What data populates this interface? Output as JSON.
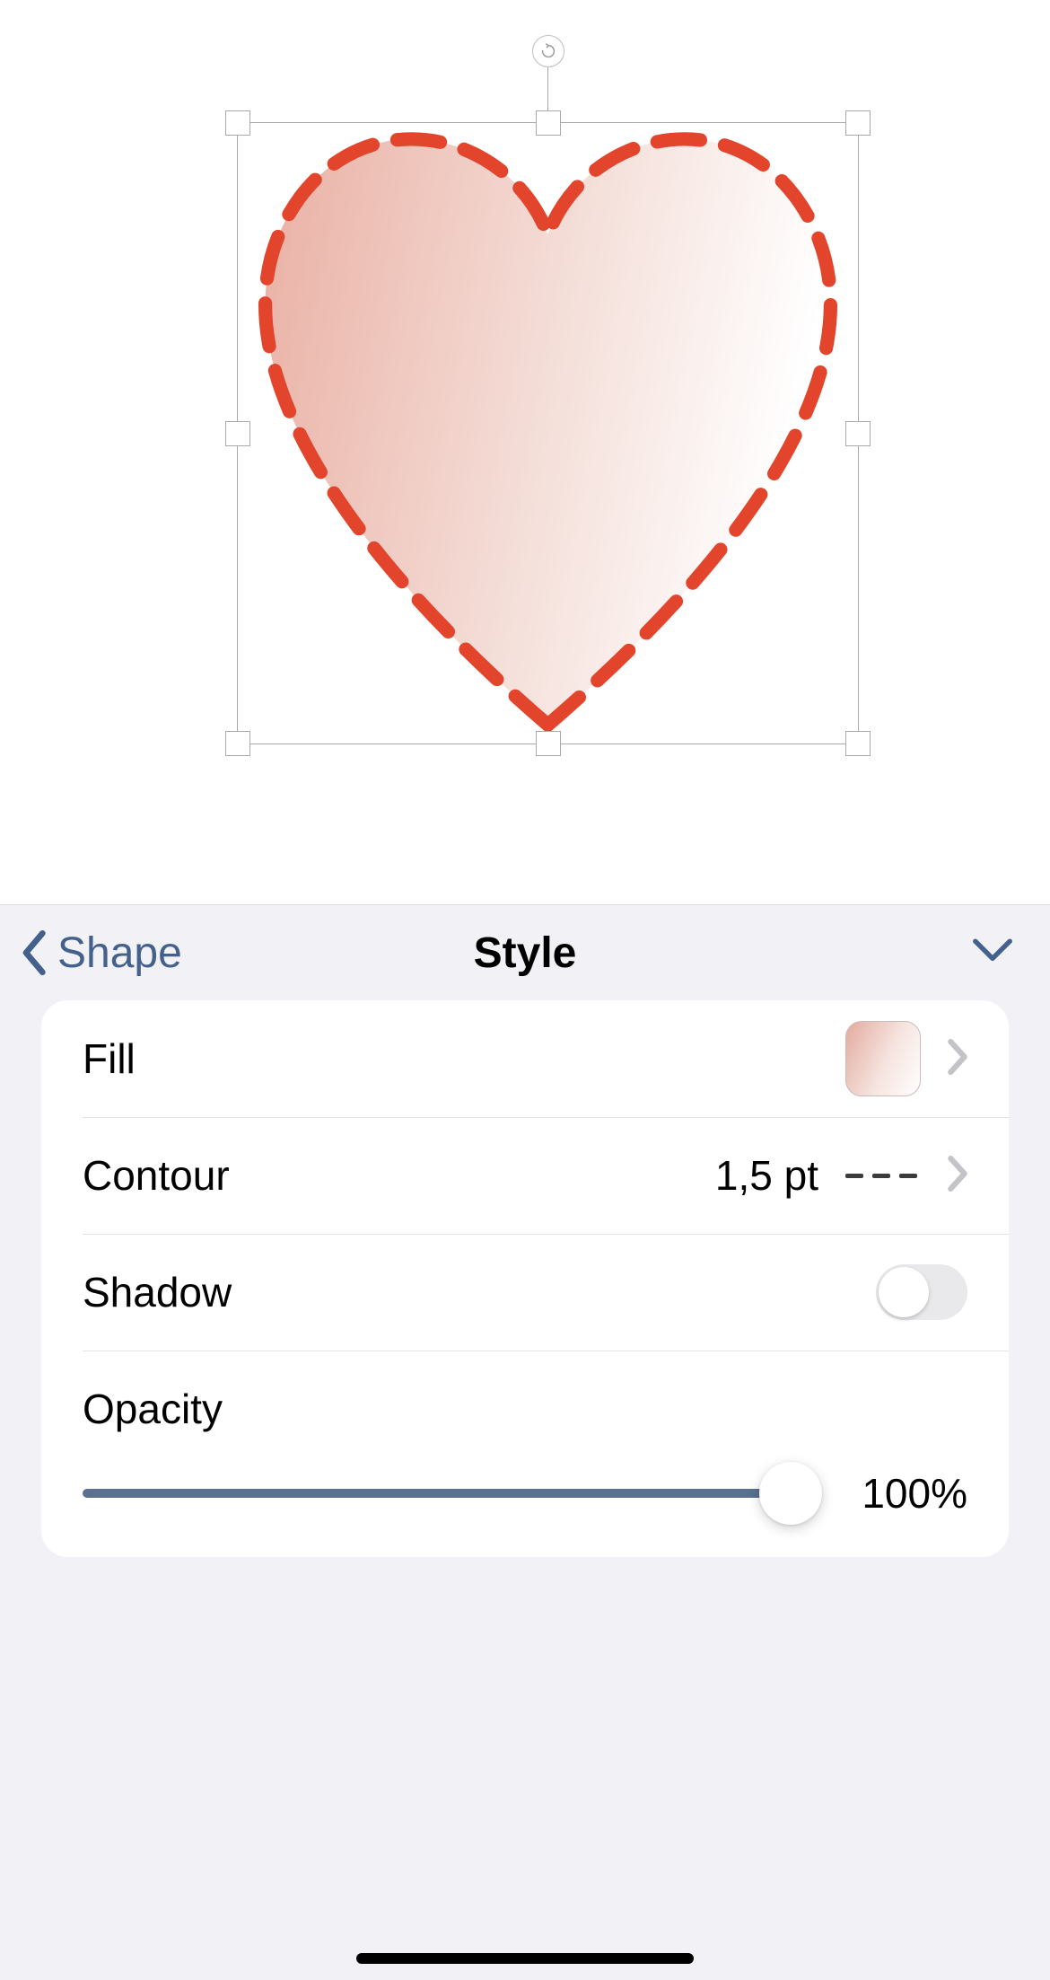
{
  "canvas": {
    "shape_type": "heart",
    "stroke_color": "#e2442c",
    "stroke_dash": "dashed",
    "fill_gradient_from": "#eab2a6",
    "fill_gradient_to": "#ffffff"
  },
  "panel": {
    "back_label": "Shape",
    "title": "Style"
  },
  "rows": {
    "fill": {
      "label": "Fill"
    },
    "contour": {
      "label": "Contour",
      "value": "1,5 pt",
      "style": "dashed"
    },
    "shadow": {
      "label": "Shadow",
      "enabled": false
    },
    "opacity": {
      "label": "Opacity",
      "value": "100%",
      "percent": 100
    }
  }
}
